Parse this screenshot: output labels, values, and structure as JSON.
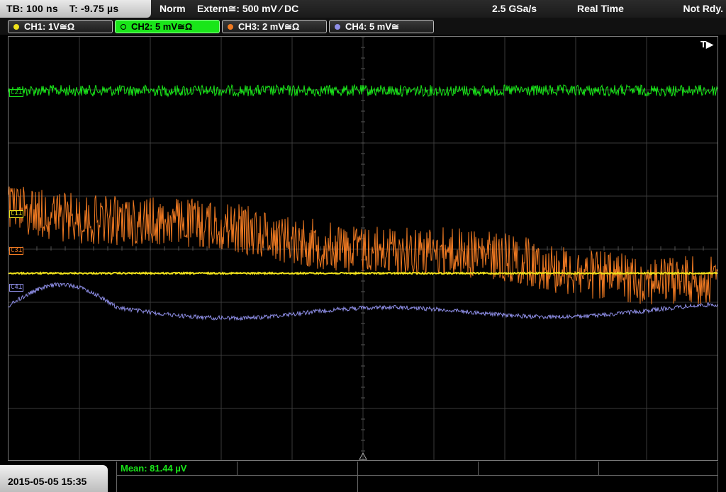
{
  "topbar": {
    "timebase": "TB: 100 ns",
    "trigger_offset": "T: -9.75 µs",
    "trigger_mode": "Norm",
    "trigger_source": "Extern≅: 500 mV ⁄ DC",
    "sample_rate": "2.5 GSa/s",
    "acquisition": "Real Time",
    "status": "Not Rdy."
  },
  "channels": [
    {
      "label": "CH1: 1V≅Ω",
      "color": "#f0e21b"
    },
    {
      "label": "CH2: 5 mV≅Ω",
      "color": "#19e619",
      "active": true
    },
    {
      "label": "CH3: 2 mV≅Ω",
      "color": "#f07a22"
    },
    {
      "label": "CH4: 5 mV≅",
      "color": "#8f8fe8"
    }
  ],
  "markers": {
    "c1": "C1⊥",
    "c2": "C2⊥",
    "c3": "C3⊥",
    "c4": "C4⊥",
    "trigger": "T▶"
  },
  "datetime": "2015-05-05 15:35",
  "measurement": {
    "label": "Mean: 81.44 µV"
  },
  "colors": {
    "ch1": "#f0e21b",
    "ch2": "#19e619",
    "ch3": "#f07a22",
    "ch4": "#8f8fe8",
    "grid": "#3a3a3a"
  }
}
